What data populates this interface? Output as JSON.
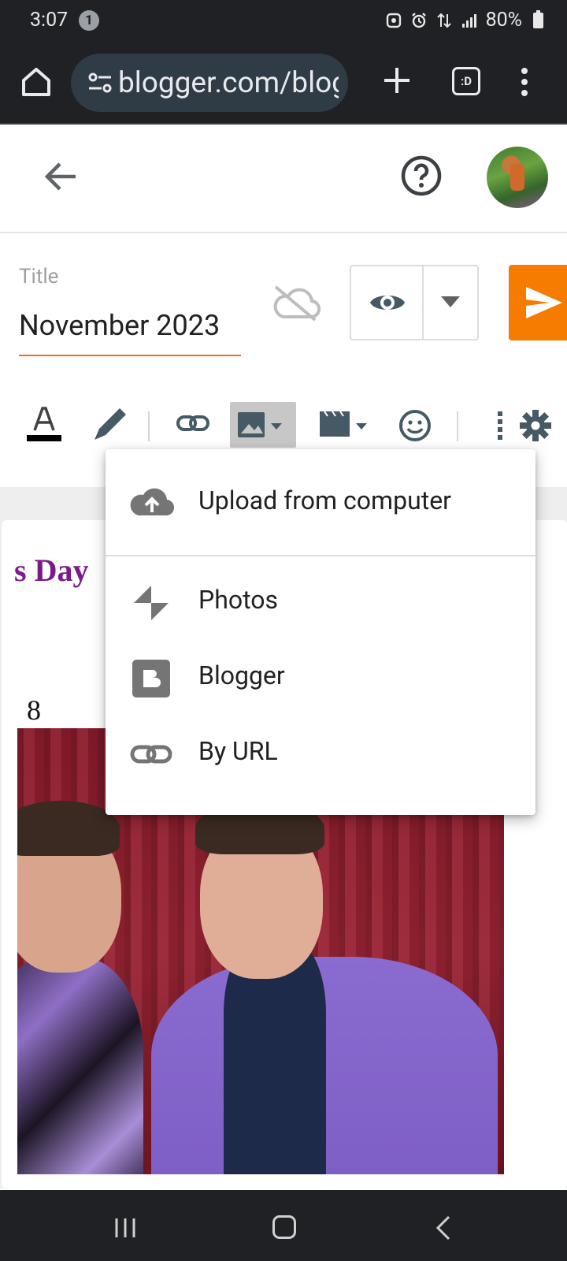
{
  "status_bar": {
    "time": "3:07",
    "notification_count": "1",
    "battery": "80%"
  },
  "browser": {
    "url": "blogger.com/blog/post/edit",
    "tab_switcher_label": ":D"
  },
  "editor": {
    "title_label": "Title",
    "title_value": "November 2023",
    "accent_color": "#f57c00",
    "post_heading": "s Day",
    "post_number": "8"
  },
  "toolbar": {
    "items": [
      "text-color",
      "highlight",
      "link",
      "insert-image",
      "insert-video",
      "emoji",
      "more",
      "settings"
    ]
  },
  "image_menu": {
    "items": [
      {
        "label": "Upload from computer",
        "icon": "upload-cloud-icon"
      },
      {
        "label": "Photos",
        "icon": "google-photos-icon"
      },
      {
        "label": "Blogger",
        "icon": "blogger-icon"
      },
      {
        "label": "By URL",
        "icon": "link-icon"
      }
    ]
  }
}
